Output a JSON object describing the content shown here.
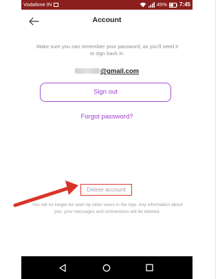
{
  "status_bar": {
    "carrier": "Vodafone IN",
    "battery": "45%",
    "time": "7:45",
    "icons": [
      "image-icon",
      "wifi-icon",
      "signal-icon",
      "battery-icon"
    ]
  },
  "header": {
    "title": "Account",
    "back_icon": "arrow-left-icon"
  },
  "info": {
    "text": "Make sure you can remember your password, as you'll need it to sign back in."
  },
  "email": {
    "domain": "@gmail.com"
  },
  "buttons": {
    "sign_out": "Sign out",
    "forgot_password": "Forgot password?",
    "delete_account": "Delete account"
  },
  "delete_note": "You will no longer be seen by other users in the App. Any information about you, your messages and connections will be deleted.",
  "nav_bar": {
    "icons": [
      "triangle-back-icon",
      "circle-home-icon",
      "square-recents-icon"
    ]
  },
  "colors": {
    "accent": "#9b3fcf",
    "status_bar": "#8a1f1d",
    "annotation": "#d9342b"
  }
}
